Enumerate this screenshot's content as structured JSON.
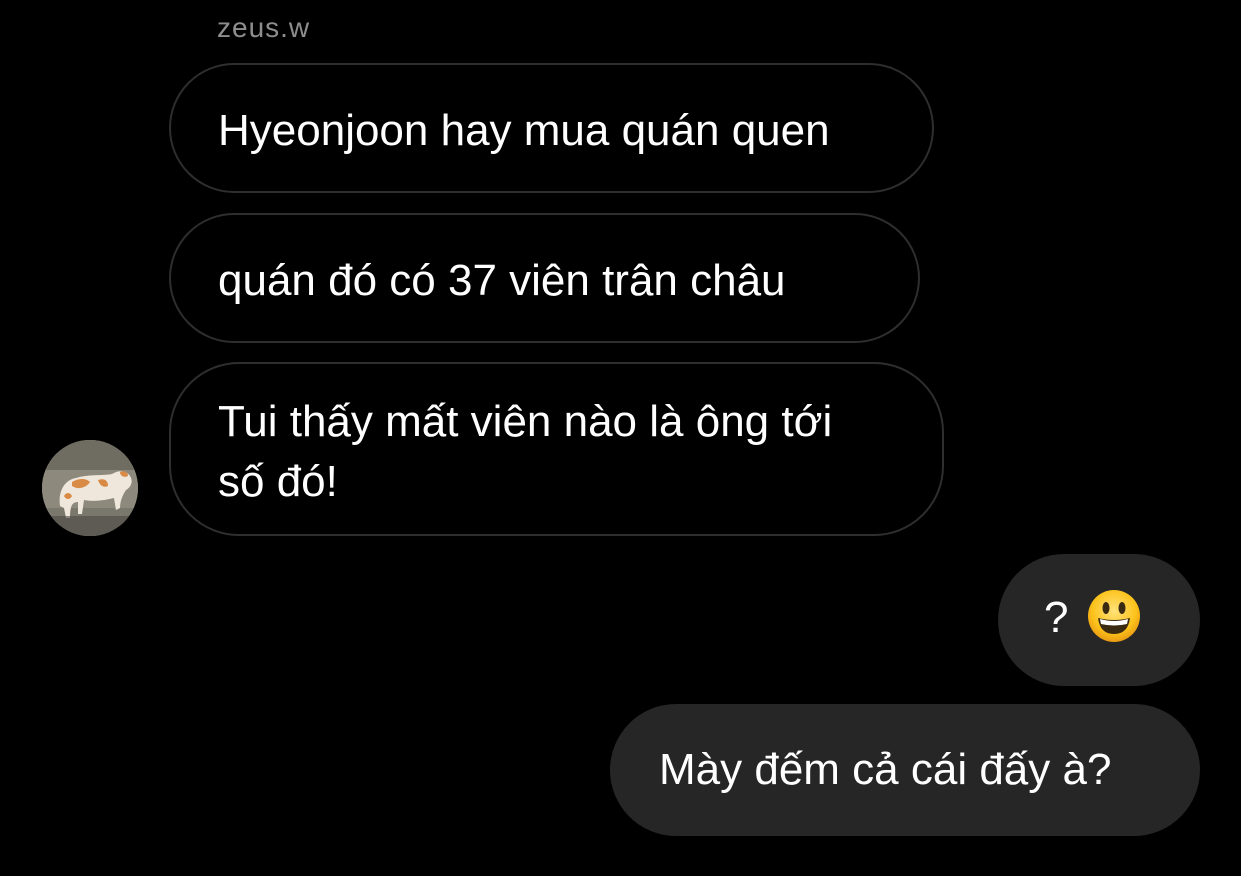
{
  "chat": {
    "sender_name": "zeus.w",
    "avatar_icon": "cat-photo-avatar",
    "incoming": [
      {
        "text": "Hyeonjoon hay mua quán quen"
      },
      {
        "text": "quán đó có 37 viên trân châu"
      },
      {
        "lines": [
          "Tui thấy mất viên nào là ông tới",
          "số đó!"
        ]
      }
    ],
    "outgoing": [
      {
        "text": "?",
        "emoji": "grinning-face-emoji"
      },
      {
        "text": "Mày đếm cả cái đấy à?"
      }
    ]
  },
  "colors": {
    "background": "#000000",
    "incoming_border": "#2e2e2e",
    "outgoing_bubble": "#262626",
    "sender_name": "#8e8e8e"
  }
}
